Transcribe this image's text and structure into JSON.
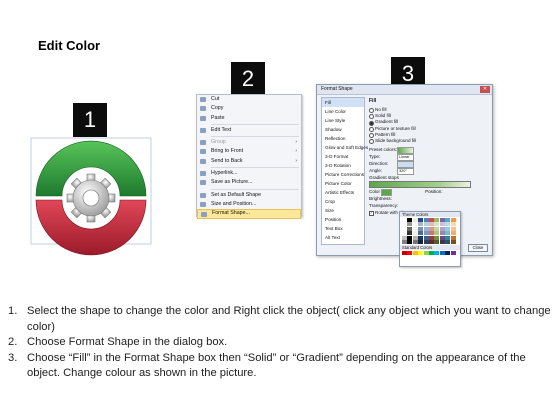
{
  "title": "Edit Color",
  "steps": [
    "1",
    "2",
    "3"
  ],
  "context_menu": {
    "items": [
      {
        "label": "Cut",
        "icon": "scissors-icon",
        "shortcut_letter": "t"
      },
      {
        "label": "Copy",
        "icon": "copy-icon"
      },
      {
        "label": "Paste",
        "icon": "paste-icon"
      },
      {
        "label": "Edit Text",
        "icon": "edit-text-icon"
      },
      {
        "label": "Group",
        "icon": "group-icon",
        "disabled": true,
        "submenu": true
      },
      {
        "label": "Bring to Front",
        "icon": "bring-front-icon",
        "submenu": true
      },
      {
        "label": "Send to Back",
        "icon": "send-back-icon",
        "submenu": true
      },
      {
        "label": "Hyperlink...",
        "icon": "hyperlink-icon"
      },
      {
        "label": "Save as Picture...",
        "icon": "save-picture-icon"
      },
      {
        "label": "Set as Default Shape",
        "icon": "default-shape-icon"
      },
      {
        "label": "Size and Position...",
        "icon": "size-position-icon"
      },
      {
        "label": "Format Shape...",
        "icon": "format-shape-icon",
        "selected": true
      }
    ]
  },
  "dialog": {
    "title": "Format Shape",
    "nav": [
      "Fill",
      "Line Color",
      "Line Style",
      "Shadow",
      "Reflection",
      "Glow and Soft Edges",
      "3-D Format",
      "3-D Rotation",
      "Picture Corrections",
      "Picture Color",
      "Artistic Effects",
      "Crop",
      "Size",
      "Position",
      "Text Box",
      "Alt Text"
    ],
    "pane_heading": "Fill",
    "fill_options": [
      "No fill",
      "Solid fill",
      "Gradient fill",
      "Picture or texture fill",
      "Pattern fill",
      "Slide background fill"
    ],
    "selected_fill": "Gradient fill",
    "fields": [
      {
        "label": "Preset colors:",
        "value": ""
      },
      {
        "label": "Type:",
        "value": "Linear"
      },
      {
        "label": "Direction:",
        "value": ""
      },
      {
        "label": "Angle:",
        "value": "320°"
      }
    ],
    "gradient_stops_label": "Gradient stops",
    "color_label": "Color",
    "position_label": "Position:",
    "brightness_label": "Brightness:",
    "transparency_label": "Transparency:",
    "rotate_label": "Rotate with shape",
    "palette_theme_label": "Theme Colors",
    "palette_standard_label": "Standard Colors",
    "close_label": "Close",
    "theme_colors": [
      "#ffffff",
      "#000000",
      "#eeece1",
      "#1f497d",
      "#4f81bd",
      "#c0504d",
      "#9bbb59",
      "#8064a2",
      "#4bacc6",
      "#f79646"
    ],
    "standard_colors": [
      "#c00000",
      "#ff0000",
      "#ffc000",
      "#ffff00",
      "#92d050",
      "#00b050",
      "#00b0f0",
      "#0070c0",
      "#002060",
      "#7030a0"
    ]
  },
  "instructions": [
    {
      "num": "1.",
      "text": "Select the shape to change the color and Right click the object( click any object which you want to change color)"
    },
    {
      "num": "2.",
      "text": "Choose Format Shape in the dialog box."
    },
    {
      "num": "3.",
      "text": "Choose “Fill” in the Format Shape box then “Solid” or “Gradient” depending on the appearance of the object. Change colour as shown in the picture."
    }
  ]
}
